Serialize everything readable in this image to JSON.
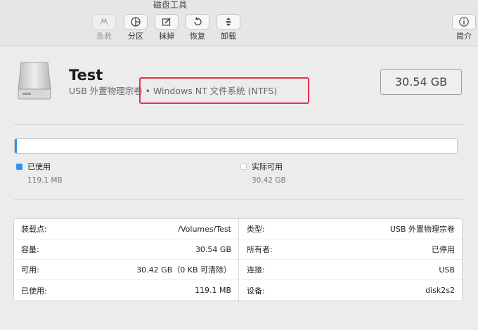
{
  "window": {
    "title": "磁盘工具"
  },
  "toolbar": {
    "items": [
      {
        "label": "急救",
        "icon": "first-aid-icon",
        "enabled": false
      },
      {
        "label": "分区",
        "icon": "partition-icon",
        "enabled": true
      },
      {
        "label": "抹掉",
        "icon": "erase-icon",
        "enabled": true
      },
      {
        "label": "恢复",
        "icon": "restore-icon",
        "enabled": true
      },
      {
        "label": "卸载",
        "icon": "unmount-icon",
        "enabled": true
      }
    ],
    "info": {
      "label": "简介",
      "icon": "info-icon"
    }
  },
  "disk": {
    "name": "Test",
    "subtitle": "USB 外置物理宗卷 • Windows NT 文件系统 (NTFS)",
    "capacity": "30.54 GB",
    "highlight_color": "#e4304c"
  },
  "usage": {
    "used_fraction": 0.0039,
    "used_color": "#2f93e8",
    "free_color": "#ffffff",
    "used": {
      "label": "已使用",
      "value": "119.1 MB"
    },
    "free": {
      "label": "实际可用",
      "value": "30.42 GB"
    }
  },
  "details": {
    "left": [
      {
        "key": "装载点:",
        "value": "/Volumes/Test"
      },
      {
        "key": "容量:",
        "value": "30.54 GB"
      },
      {
        "key": "可用:",
        "value": "30.42 GB（0 KB 可清除）"
      },
      {
        "key": "已使用:",
        "value": "119.1 MB"
      }
    ],
    "right": [
      {
        "key": "类型:",
        "value": "USB 外置物理宗卷"
      },
      {
        "key": "所有者:",
        "value": "已停用"
      },
      {
        "key": "连接:",
        "value": "USB"
      },
      {
        "key": "设备:",
        "value": "disk2s2"
      }
    ]
  }
}
